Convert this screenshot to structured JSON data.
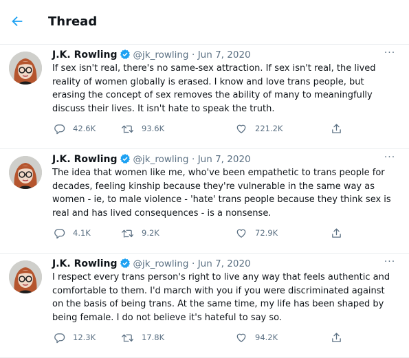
{
  "header": {
    "title": "Thread",
    "back_icon": "arrow-left-icon"
  },
  "colors": {
    "accent": "#1da1f2",
    "muted": "#5b7083",
    "text": "#0f1419",
    "divider": "#ebeef0"
  },
  "tweets": [
    {
      "name": "J.K. Rowling",
      "handle": "@jk_rowling",
      "separator": "·",
      "date": "Jun 7, 2020",
      "more": "···",
      "text": "If sex isn't real, there's no same-sex attraction. If sex isn't real, the lived\nreality of women globally is erased. I know and love trans people, but\nerasing the concept of sex removes the ability of many to meaningfully\ndiscuss their lives. It isn't hate to speak the truth.",
      "replies": "42.6K",
      "retweets": "93.6K",
      "likes": "221.2K"
    },
    {
      "name": "J.K. Rowling",
      "handle": "@jk_rowling",
      "separator": "·",
      "date": "Jun 7, 2020",
      "more": "···",
      "text": "The idea that women like me, who've been empathetic to trans people for\ndecades, feeling kinship because they're vulnerable in the same way as\nwomen - ie, to male violence - 'hate' trans people because they think sex is\nreal and has lived consequences - is a nonsense.",
      "replies": "4.1K",
      "retweets": "9.2K",
      "likes": "72.9K"
    },
    {
      "name": "J.K. Rowling",
      "handle": "@jk_rowling",
      "separator": "·",
      "date": "Jun 7, 2020",
      "more": "···",
      "text": "I respect every trans person's right to live any way that feels authentic and\ncomfortable to them. I'd march with you if you were discriminated against\non the basis of being trans. At the same time, my life has been shaped by\nbeing female. I do not believe it's hateful to say so.",
      "replies": "12.3K",
      "retweets": "17.8K",
      "likes": "94.2K"
    }
  ]
}
